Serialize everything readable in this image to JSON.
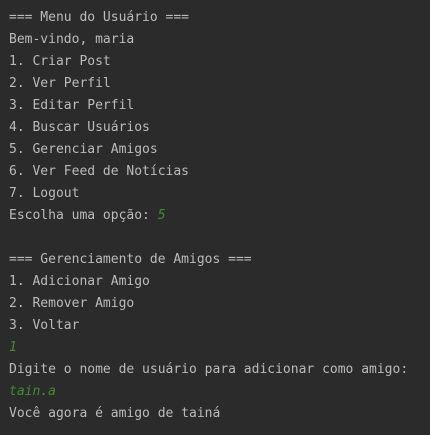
{
  "console": {
    "menu_header": "=== Menu do Usuário ===",
    "welcome": "Bem-vindo, maria",
    "menu_items": [
      "1. Criar Post",
      "2. Ver Perfil",
      "3. Editar Perfil",
      "4. Buscar Usuários",
      "5. Gerenciar Amigos",
      "6. Ver Feed de Notícias",
      "7. Logout"
    ],
    "choose_prompt": "Escolha uma opção: ",
    "choose_input": "5",
    "friends_header": "=== Gerenciamento de Amigos ===",
    "friends_items": [
      "1. Adicionar Amigo",
      "2. Remover Amigo",
      "3. Voltar"
    ],
    "friends_input": "1",
    "username_prompt": "Digite o nome de usuário para adicionar como amigo:",
    "username_input": "tain.a",
    "result": "Você agora é amigo de tainá"
  },
  "colors": {
    "background": "#2b2b2b",
    "text": "#bbbbbb",
    "user_input": "#5aa32b"
  }
}
